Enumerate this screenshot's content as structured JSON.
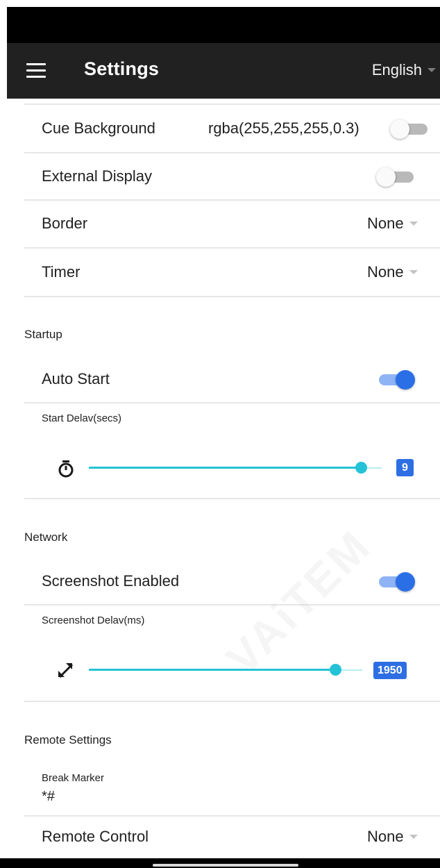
{
  "app_bar": {
    "title": "Settings",
    "language": "English"
  },
  "display": {
    "cue_background": {
      "label": "Cue Background",
      "value": "rgba(255,255,255,0.3)",
      "enabled": false
    },
    "external_display": {
      "label": "External Display",
      "enabled": false
    },
    "border": {
      "label": "Border",
      "value": "None"
    },
    "timer": {
      "label": "Timer",
      "value": "None"
    }
  },
  "startup": {
    "header": "Startup",
    "auto_start": {
      "label": "Auto Start",
      "enabled": true
    },
    "start_delay": {
      "label": "Start Delav(secs)",
      "value": "9",
      "level": 0.93
    }
  },
  "network": {
    "header": "Network",
    "screenshot_enabled": {
      "label": "Screenshot Enabled",
      "enabled": true
    },
    "screenshot_delay": {
      "label": "Screenshot Delav(ms)",
      "value": "1950",
      "level": 0.9
    }
  },
  "remote": {
    "header": "Remote Settings",
    "break_marker": {
      "label": "Break Marker",
      "value": "*#"
    },
    "remote_control": {
      "label": "Remote Control",
      "value": "None"
    }
  },
  "watermark": "VAiTEM",
  "icons": {
    "menu": "hamburger-menu-icon",
    "timer": "stopwatch-icon",
    "screenshot": "expand-arrows-icon",
    "dropdown": "caret-down-icon"
  },
  "colors": {
    "app_bar": "#212121",
    "toggle_on": "#2b6fe6",
    "slider": "#24c2d6",
    "badge": "#2d6fe3"
  }
}
